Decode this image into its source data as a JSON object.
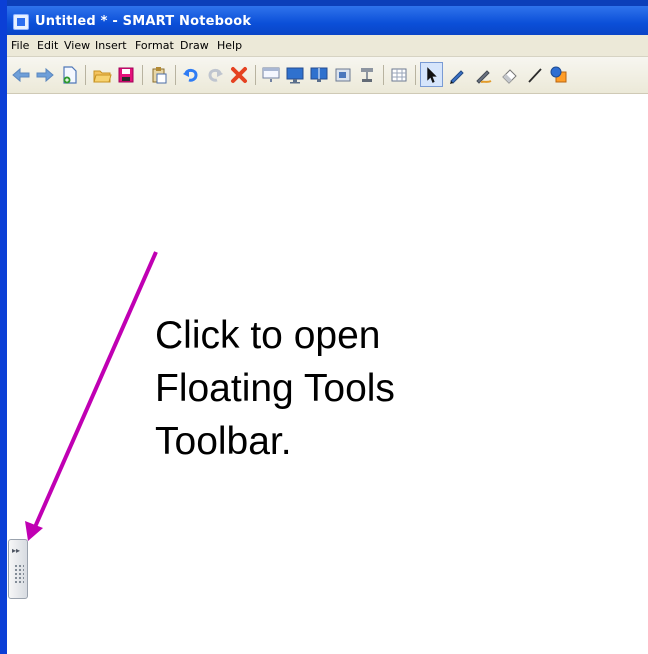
{
  "window": {
    "title": "Untitled * - SMART Notebook",
    "icon": "smart-notebook-icon"
  },
  "menu": [
    "File",
    "Edit",
    "View",
    "Insert",
    "Format",
    "Draw",
    "Help"
  ],
  "toolbar": {
    "icons": [
      "back-arrow-icon",
      "forward-arrow-icon",
      "new-page-icon",
      "open-folder-icon",
      "save-icon",
      "paste-icon",
      "undo-icon",
      "redo-icon",
      "delete-icon",
      "screen-shade-icon",
      "full-screen-icon",
      "dual-page-icon",
      "capture-icon",
      "document-camera-icon",
      "table-icon",
      "select-pointer-icon",
      "pen-icon",
      "creative-pen-icon",
      "eraser-icon",
      "line-icon",
      "shapes-icon"
    ]
  },
  "annotation": {
    "text": "Click to open\nFloating Tools\nToolbar.",
    "arrow_color": "#c000b3"
  },
  "floating_tools_handle": {
    "glyph": "▸▸"
  },
  "colors": {
    "titlebar_blue": "#0b4fd8",
    "menubar_bg": "#ece9d8",
    "arrow_magenta": "#c000b3"
  }
}
